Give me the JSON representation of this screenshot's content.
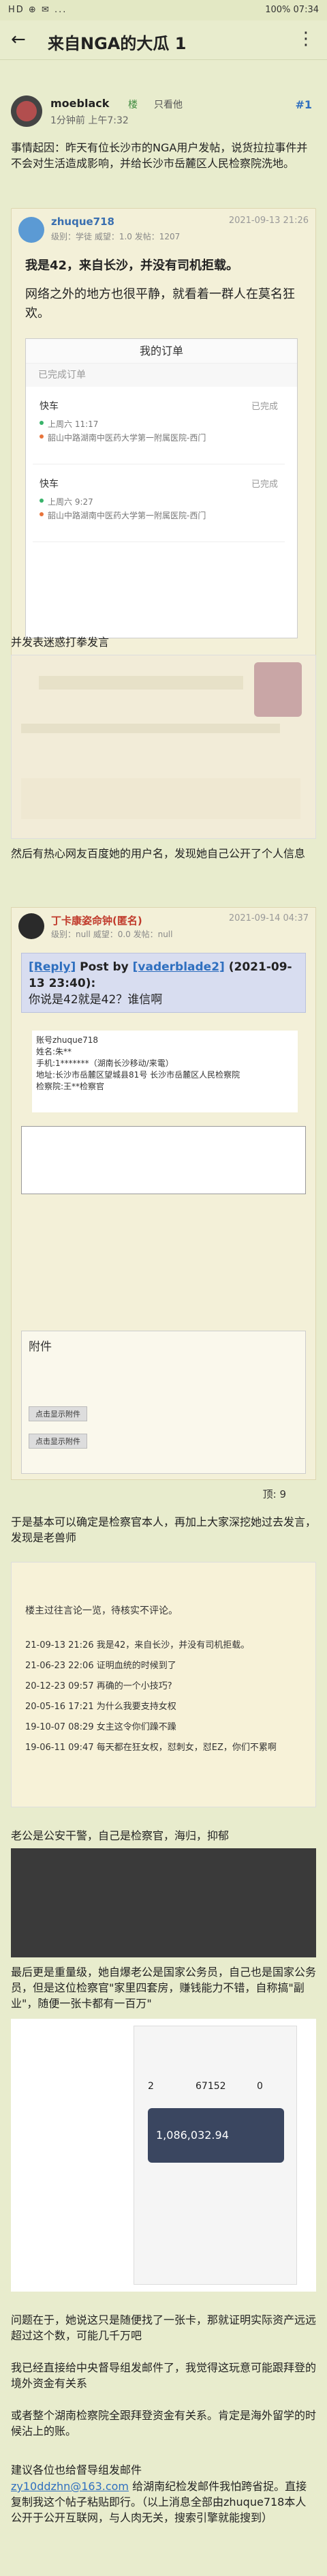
{
  "status_bar": {
    "left": "HD ⊕ ✉ ...",
    "right": "100% 07:34"
  },
  "header": {
    "title": "来自NGA的大瓜 1",
    "back_icon": "back-arrow-icon",
    "more_icon": "more-dots-icon"
  },
  "post": {
    "author": "moeblack",
    "badge": "楼",
    "only_op": "只看他",
    "time": "1分钟前 上午7:32",
    "floor": "#1",
    "intro": "事情起因：昨天有位长沙市的NGA用户发帖，说货拉拉事件并不会对生活造成影响，并给长沙市岳麓区人民检察院洗地。"
  },
  "quote1": {
    "name": "zhuque718",
    "date": "2021-09-13 21:26",
    "info": "级别：学徒  威望：1.0  发帖：1207",
    "text1": "我是42，来自长沙，并没有司机拒载。",
    "text2": "网络之外的地方也很平静，就看着一群人在莫名狂欢。",
    "order_title": "我的订单",
    "order_tab": "已完成订单",
    "orders": [
      {
        "type": "快车",
        "status": "已完成",
        "time": "上周六 11:17",
        "addr": "韶山中路湖南中医药大学第一附属医院-西门"
      },
      {
        "type": "快车",
        "status": "已完成",
        "time": "上周六 9:27",
        "addr": "韶山中路湖南中医药大学第一附属医院-西门"
      }
    ]
  },
  "text_doxx": "并发表迷惑打拳发言",
  "text_hot": "然后有热心网友百度她的用户名，发现她自己公开了个人信息",
  "reply": {
    "name": "丁卡康姿命钟(匿名)",
    "date": "2021-09-14 04:37",
    "info": "级别：null  威望：0.0  发帖：null",
    "quote_link": "[Reply]",
    "quote_by": " Post by ",
    "quote_user": "[vaderblade2]",
    "quote_time": " (2021-09-13 23:40):",
    "quote_text": "你说是42就是42？谁信啊",
    "profile": "账号zhuque718\n姓名:朱**\n手机:1*******（湖南长沙移动/来電）\n地址:长沙市岳麓区望城县81号 长沙市岳麓区人民检察院\n检察院:王**检察官",
    "attach_title": "附件",
    "attach_btn1": "点击显示附件",
    "attach_btn2": "点击显示附件",
    "likes": "顶: 9"
  },
  "text_confirm": "于是基本可以确定是检察官本人，再加上大家深挖她过去发言，发现是老兽师",
  "posts_history": {
    "title": "楼主过往言论一览，待核实不评论。",
    "lines": [
      "21-09-13 21:26 我是42，来自长沙，并没有司机拒载。",
      "21-06-23 22:06 证明血统的时候到了",
      "20-12-23 09:57 再确的一个小技巧?",
      "20-05-16 17:21 为什么我要支持女权",
      "19-10-07 08:29 女主这令你们躁不躁",
      "19-06-11 09:47 每天都在狂女权，怼刺女，怼EZ，你们不累啊"
    ]
  },
  "text_police": "老公是公安干警，自己是检察官，海归，抑郁",
  "text_salary": "最后更是重量级，她自爆老公是国家公务员，自己也是国家公务员，但是这位检察官\"家里四套房，赚钱能力不错，自称搞\"副业\"，随便一张卡都有一百万\"",
  "bank": {
    "number1": "2",
    "number2": "67152",
    "number3": "0",
    "balance": "1,086,032.94"
  },
  "text_question": "问题在于，她说这只是随便找了一张卡，那就证明实际资产远远超过这个数，可能几千万吧",
  "text_report": "我已经直接给中央督导组发邮件了，我觉得这玩意可能跟拜登的境外资金有关系",
  "text_party": "或者整个湖南检察院全跟拜登资金有关系。肯定是海外留学的时候沾上的账。",
  "text_suggest": "建议各位也给督导组发邮件",
  "email": "zy10ddzhn@163.com",
  "text_suggest2": " 给湖南纪检发邮件我怕跨省捉。直接复制我这个帖子粘贴即行。（以上消息全部由zhuque718本人公开于公开互联网，与人肉无关，搜索引擎就能搜到）"
}
